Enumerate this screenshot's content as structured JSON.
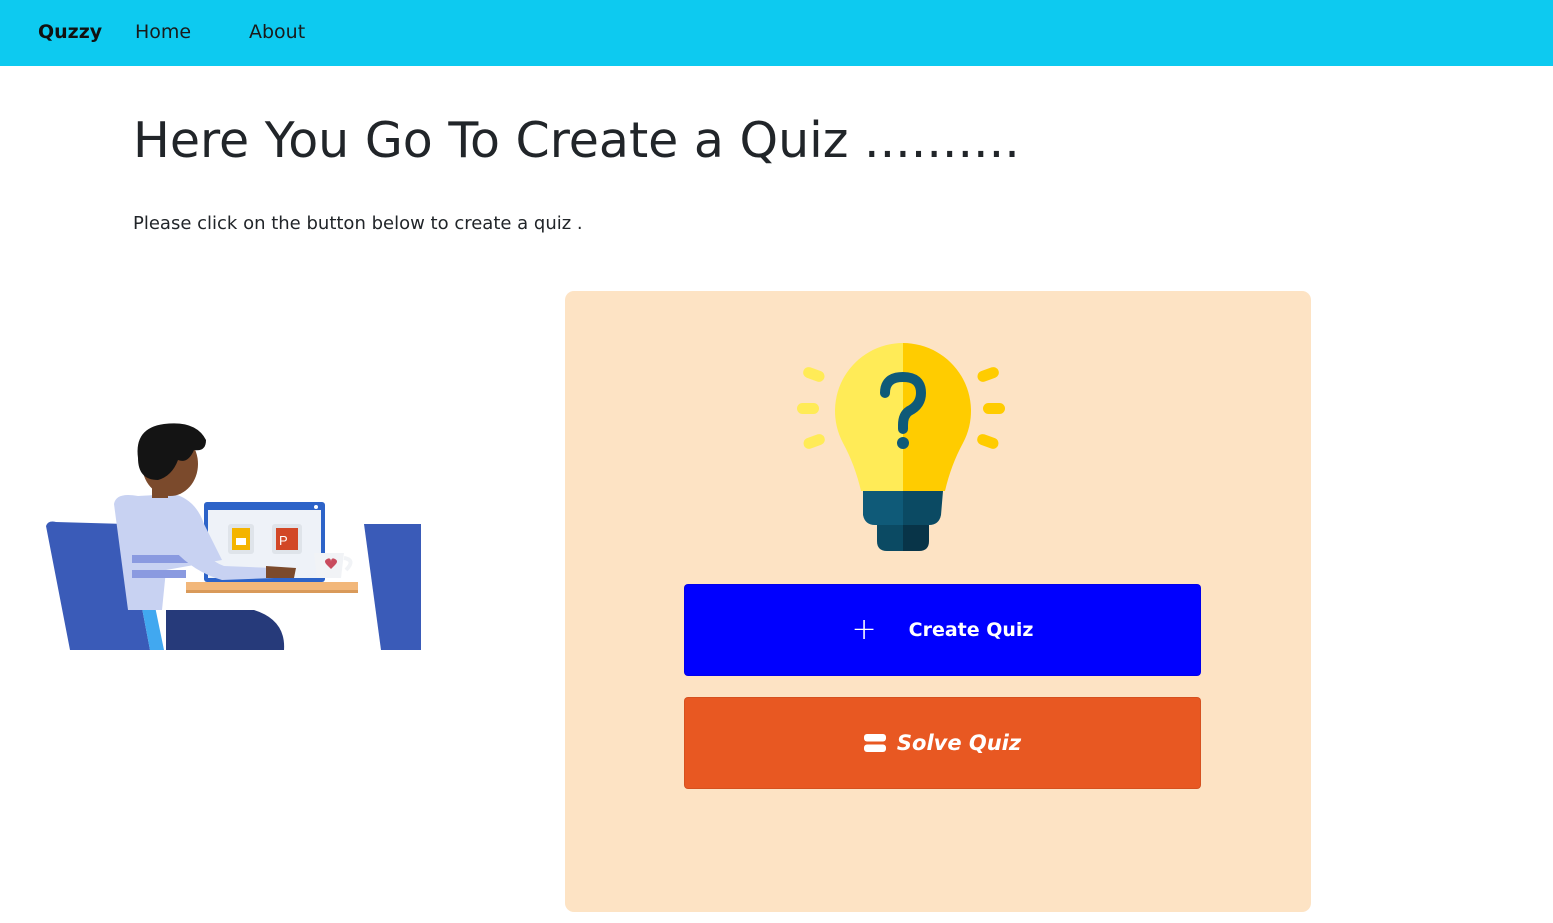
{
  "nav": {
    "brand": "Quzzy",
    "links": [
      {
        "label": "Home"
      },
      {
        "label": "About"
      }
    ]
  },
  "hero": {
    "title": "Here You Go To Create a Quiz ..........",
    "subtitle": "Please click on the button below to create a quiz ."
  },
  "actions": {
    "create_label": "Create Quiz",
    "create_icon": "plus-icon",
    "solve_label": "Solve Quiz",
    "solve_icon": "list-icon"
  },
  "colors": {
    "navbar": "#0dcaf0",
    "panel": "#fde3c4",
    "create_button": "#0000ff",
    "solve_button": "#e85822",
    "bulb_light": "#ffeb57",
    "bulb_dark": "#ffcc00"
  },
  "illustration": "person-working-at-laptop",
  "panel_icon": "lightbulb-question-icon"
}
